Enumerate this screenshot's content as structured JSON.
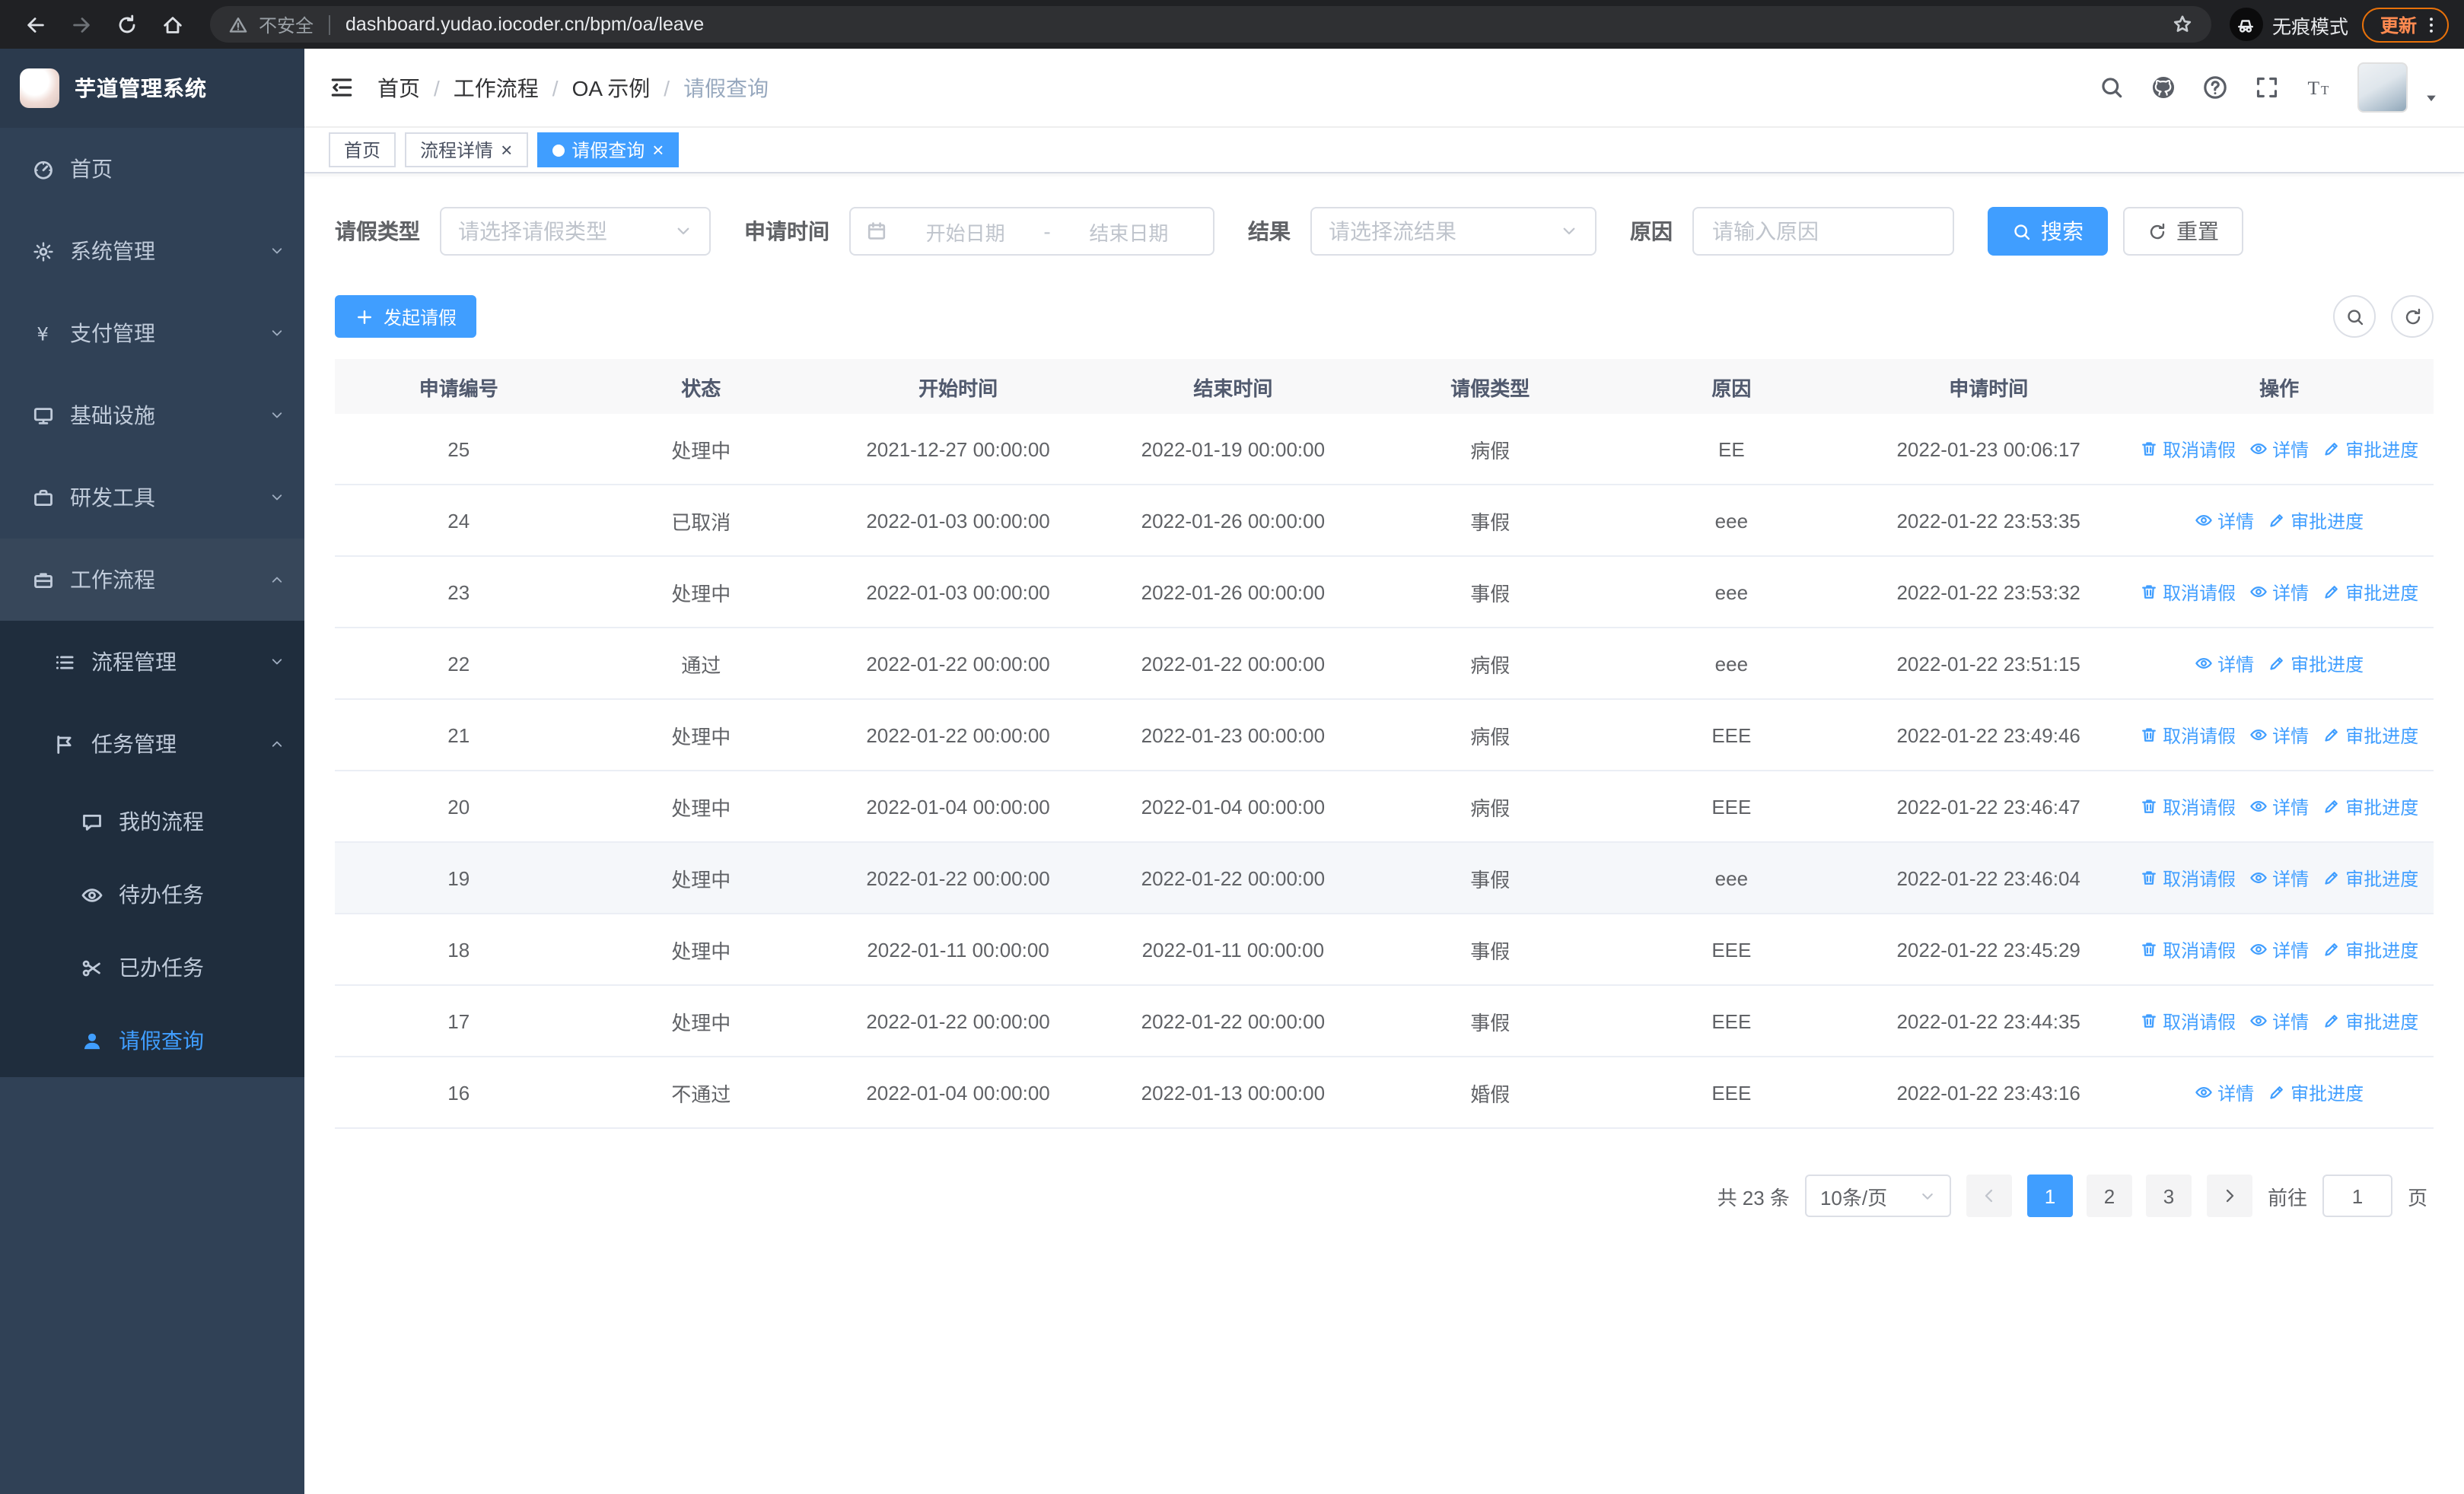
{
  "browser": {
    "security_label": "不安全",
    "url": "dashboard.yudao.iocoder.cn/bpm/oa/leave",
    "incognito_label": "无痕模式",
    "update_label": "更新"
  },
  "sidebar": {
    "logo_title": "芋道管理系统",
    "items": [
      {
        "label": "首页",
        "icon": "dashboard-icon",
        "level": 1,
        "expandable": false
      },
      {
        "label": "系统管理",
        "icon": "gear-icon",
        "level": 1,
        "expandable": true,
        "expanded": false
      },
      {
        "label": "支付管理",
        "icon": "yen-icon",
        "level": 1,
        "expandable": true,
        "expanded": false
      },
      {
        "label": "基础设施",
        "icon": "monitor-icon",
        "level": 1,
        "expandable": true,
        "expanded": false
      },
      {
        "label": "研发工具",
        "icon": "toolbox-icon",
        "level": 1,
        "expandable": true,
        "expanded": false
      },
      {
        "label": "工作流程",
        "icon": "suitcase-icon",
        "level": 1,
        "expandable": true,
        "expanded": true,
        "section": true
      },
      {
        "label": "流程管理",
        "icon": "list-icon",
        "level": 2,
        "expandable": true,
        "expanded": false
      },
      {
        "label": "任务管理",
        "icon": "flag-icon",
        "level": 2,
        "expandable": true,
        "expanded": true
      },
      {
        "label": "我的流程",
        "icon": "chat-icon",
        "level": 3
      },
      {
        "label": "待办任务",
        "icon": "eye-icon",
        "level": 3
      },
      {
        "label": "已办任务",
        "icon": "scissors-icon",
        "level": 3
      },
      {
        "label": "请假查询",
        "icon": "user-icon",
        "level": 3,
        "active": true
      }
    ]
  },
  "header": {
    "breadcrumb": [
      "首页",
      "工作流程",
      "OA 示例",
      "请假查询"
    ],
    "icons": [
      "search-icon",
      "github-icon",
      "help-icon",
      "fullscreen-icon",
      "font-size-icon"
    ]
  },
  "tabs": [
    {
      "label": "首页",
      "closable": false,
      "active": false
    },
    {
      "label": "流程详情",
      "closable": true,
      "active": false
    },
    {
      "label": "请假查询",
      "closable": true,
      "active": true
    }
  ],
  "filters": {
    "leave_type_label": "请假类型",
    "leave_type_placeholder": "请选择请假类型",
    "apply_time_label": "申请时间",
    "start_date_placeholder": "开始日期",
    "date_separator": "-",
    "end_date_placeholder": "结束日期",
    "result_label": "结果",
    "result_placeholder": "请选择流结果",
    "reason_label": "原因",
    "reason_placeholder": "请输入原因",
    "search_label": "搜索",
    "reset_label": "重置"
  },
  "toolbar": {
    "create_label": "发起请假"
  },
  "table": {
    "columns": [
      "申请编号",
      "状态",
      "开始时间",
      "结束时间",
      "请假类型",
      "原因",
      "申请时间",
      "操作"
    ],
    "actions": {
      "cancel": "取消请假",
      "detail": "详情",
      "progress": "审批进度"
    },
    "rows": [
      {
        "id": "25",
        "status": "处理中",
        "start": "2021-12-27 00:00:00",
        "end": "2022-01-19 00:00:00",
        "type": "病假",
        "reason": "EE",
        "apply_time": "2022-01-23 00:06:17",
        "cancellable": true
      },
      {
        "id": "24",
        "status": "已取消",
        "start": "2022-01-03 00:00:00",
        "end": "2022-01-26 00:00:00",
        "type": "事假",
        "reason": "eee",
        "apply_time": "2022-01-22 23:53:35",
        "cancellable": false
      },
      {
        "id": "23",
        "status": "处理中",
        "start": "2022-01-03 00:00:00",
        "end": "2022-01-26 00:00:00",
        "type": "事假",
        "reason": "eee",
        "apply_time": "2022-01-22 23:53:32",
        "cancellable": true
      },
      {
        "id": "22",
        "status": "通过",
        "start": "2022-01-22 00:00:00",
        "end": "2022-01-22 00:00:00",
        "type": "病假",
        "reason": "eee",
        "apply_time": "2022-01-22 23:51:15",
        "cancellable": false
      },
      {
        "id": "21",
        "status": "处理中",
        "start": "2022-01-22 00:00:00",
        "end": "2022-01-23 00:00:00",
        "type": "病假",
        "reason": "EEE",
        "apply_time": "2022-01-22 23:49:46",
        "cancellable": true
      },
      {
        "id": "20",
        "status": "处理中",
        "start": "2022-01-04 00:00:00",
        "end": "2022-01-04 00:00:00",
        "type": "病假",
        "reason": "EEE",
        "apply_time": "2022-01-22 23:46:47",
        "cancellable": true
      },
      {
        "id": "19",
        "status": "处理中",
        "start": "2022-01-22 00:00:00",
        "end": "2022-01-22 00:00:00",
        "type": "事假",
        "reason": "eee",
        "apply_time": "2022-01-22 23:46:04",
        "cancellable": true,
        "highlighted": true
      },
      {
        "id": "18",
        "status": "处理中",
        "start": "2022-01-11 00:00:00",
        "end": "2022-01-11 00:00:00",
        "type": "事假",
        "reason": "EEE",
        "apply_time": "2022-01-22 23:45:29",
        "cancellable": true
      },
      {
        "id": "17",
        "status": "处理中",
        "start": "2022-01-22 00:00:00",
        "end": "2022-01-22 00:00:00",
        "type": "事假",
        "reason": "EEE",
        "apply_time": "2022-01-22 23:44:35",
        "cancellable": true
      },
      {
        "id": "16",
        "status": "不通过",
        "start": "2022-01-04 00:00:00",
        "end": "2022-01-13 00:00:00",
        "type": "婚假",
        "reason": "EEE",
        "apply_time": "2022-01-22 23:43:16",
        "cancellable": false
      }
    ]
  },
  "pagination": {
    "total_label": "共 23 条",
    "page_size_label": "10条/页",
    "pages": [
      "1",
      "2",
      "3"
    ],
    "active_page": "1",
    "goto_label": "前往",
    "goto_value": "1",
    "page_unit": "页"
  }
}
